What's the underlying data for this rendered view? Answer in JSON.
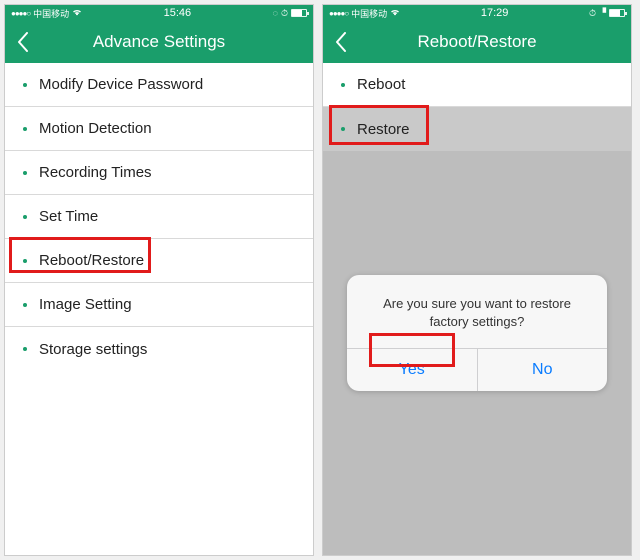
{
  "left": {
    "status": {
      "carrier": "中国移动",
      "time": "15:46"
    },
    "title": "Advance Settings",
    "items": [
      {
        "label": "Modify Device Password"
      },
      {
        "label": "Motion Detection"
      },
      {
        "label": "Recording Times"
      },
      {
        "label": "Set Time"
      },
      {
        "label": "Reboot/Restore"
      },
      {
        "label": "Image Setting"
      },
      {
        "label": "Storage settings"
      }
    ]
  },
  "right": {
    "status": {
      "carrier": "中国移动",
      "time": "17:29"
    },
    "title": "Reboot/Restore",
    "items": [
      {
        "label": "Reboot"
      },
      {
        "label": "Restore"
      }
    ],
    "alert": {
      "message": "Are you sure you want to restore factory settings?",
      "yes": "Yes",
      "no": "No"
    }
  }
}
